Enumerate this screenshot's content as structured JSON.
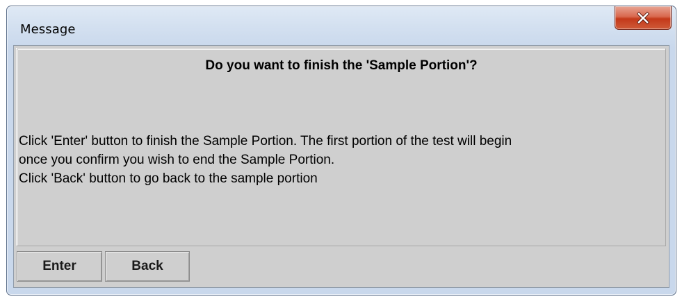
{
  "window": {
    "title": "Message",
    "close_icon": "close-icon"
  },
  "message": {
    "heading": "Do you want to finish the 'Sample Portion'?",
    "lines": [
      "Click 'Enter' button to finish the Sample Portion. The first portion of the test will begin",
      "once you confirm you wish to end the Sample Portion.",
      "Click 'Back' button to go back to the sample portion"
    ]
  },
  "buttons": {
    "enter_label": "Enter",
    "back_label": "Back"
  },
  "colors": {
    "panel_bg": "#cfcfcf",
    "close_button": "#c4391a",
    "title_bar": "#d3e0f0"
  }
}
